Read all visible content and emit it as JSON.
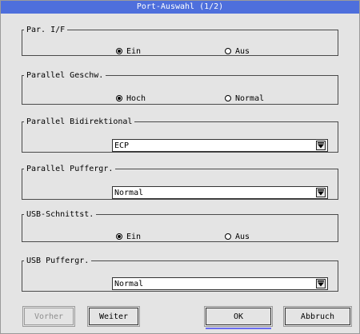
{
  "window": {
    "title": "Port-Auswahl (1/2)"
  },
  "groups": {
    "par_if": {
      "label": "Par. I/F",
      "options": [
        {
          "label": "Ein",
          "selected": true
        },
        {
          "label": "Aus",
          "selected": false
        }
      ]
    },
    "par_speed": {
      "label": "Parallel Geschw.",
      "options": [
        {
          "label": "Hoch",
          "selected": true
        },
        {
          "label": "Normal",
          "selected": false
        }
      ]
    },
    "par_bidir": {
      "label": "Parallel Bidirektional",
      "value": "ECP"
    },
    "par_buffer": {
      "label": "Parallel Puffergr.",
      "value": "Normal"
    },
    "usb_if": {
      "label": "USB-Schnittst.",
      "options": [
        {
          "label": "Ein",
          "selected": true
        },
        {
          "label": "Aus",
          "selected": false
        }
      ]
    },
    "usb_buffer": {
      "label": "USB Puffergr.",
      "value": "Normal"
    }
  },
  "buttons": {
    "back": "Vorher",
    "next": "Weiter",
    "ok": "OK",
    "cancel": "Abbruch"
  },
  "colors": {
    "titlebar": "#4e6fdc",
    "background": "#e4e4e4",
    "focus": "#6a6cf0"
  }
}
